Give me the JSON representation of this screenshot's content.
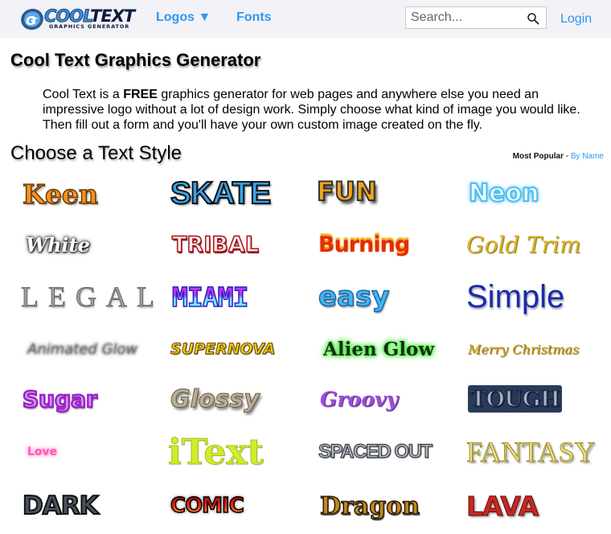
{
  "header": {
    "logo_main_part1": "COOL",
    "logo_main_part2": "TEXT",
    "logo_sub": "GRAPHICS GENERATOR",
    "logo_mark": "CT",
    "nav": [
      {
        "label": "Logos ▼"
      },
      {
        "label": "Fonts"
      }
    ],
    "search_placeholder": "Search...",
    "login_label": "Login"
  },
  "main": {
    "title": "Cool Text Graphics Generator",
    "intro_before": "Cool Text is a ",
    "intro_bold": "FREE",
    "intro_after": " graphics generator for web pages and anywhere else you need an impressive logo without a lot of design work. Simply choose what kind of image you would like. Then fill out a form and you'll have your own custom image created on the fly.",
    "section_title": "Choose a Text Style",
    "sort_active": "Most Popular",
    "sort_separator": " - ",
    "sort_link": "By Name"
  },
  "styles": [
    {
      "label": "Keen",
      "color": "#f7921e"
    },
    {
      "label": "SKATE",
      "color": "#36a3ee"
    },
    {
      "label": "FUN",
      "color": "#f5a21c"
    },
    {
      "label": "Neon",
      "color": "#8fd8ff"
    },
    {
      "label": "White",
      "color": "#ffffff"
    },
    {
      "label": "TRIBAL",
      "color": "#f3eaea"
    },
    {
      "label": "Burning",
      "color": "#e32c0a"
    },
    {
      "label": "Gold Trim",
      "color": "#d8b42c"
    },
    {
      "label": "LEGAL",
      "color": "#888888"
    },
    {
      "label": "MIAMI",
      "color": "#9b3cf4"
    },
    {
      "label": "easy",
      "color": "#46b3f1"
    },
    {
      "label": "Simple",
      "color": "#1a2aa8"
    },
    {
      "label": "Animated Glow",
      "color": "#777777"
    },
    {
      "label": "SUPERNOVA",
      "color": "#f2c90e"
    },
    {
      "label": "Alien Glow",
      "color": "#1c2a1c"
    },
    {
      "label": "Merry Christmas",
      "color": "#c99b1c"
    },
    {
      "label": "Sugar",
      "color": "#b14ed8"
    },
    {
      "label": "Glossy",
      "color": "#a4937a"
    },
    {
      "label": "Groovy",
      "color": "#9a4ed8"
    },
    {
      "label": "TOUGH",
      "color": "#8b9bb0"
    },
    {
      "label": "Love",
      "color": "#ff5ab4"
    },
    {
      "label": "iText",
      "color": "#d2ec2a"
    },
    {
      "label": "SPACED OUT",
      "color": "#9aa0a6"
    },
    {
      "label": "FANTASY",
      "color": "#eee27a"
    },
    {
      "label": "DARK",
      "color": "#4a5360"
    },
    {
      "label": "COMIC",
      "color": "#e0441a"
    },
    {
      "label": "Dragon",
      "color": "#c0881c"
    },
    {
      "label": "LAVA",
      "color": "#c22a22"
    }
  ]
}
